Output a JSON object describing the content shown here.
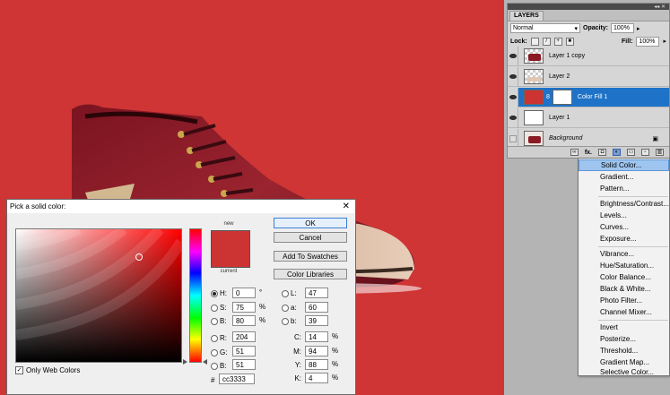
{
  "layers_panel": {
    "tab": "LAYERS",
    "blend_mode": "Normal",
    "opacity_label": "Opacity:",
    "opacity_value": "100%",
    "lock_label": "Lock:",
    "fill_label": "Fill:",
    "fill_value": "100%",
    "layers": [
      {
        "name": "Layer 1 copy",
        "visible": true,
        "selected": false
      },
      {
        "name": "Layer 2",
        "visible": true,
        "selected": false
      },
      {
        "name": "Color Fill 1",
        "visible": true,
        "selected": true
      },
      {
        "name": "Layer 1",
        "visible": true,
        "selected": false
      },
      {
        "name": "Background",
        "visible": false,
        "selected": false
      }
    ],
    "bottom_fx": "fx."
  },
  "adjust_menu": {
    "items": [
      "Solid Color...",
      "Gradient...",
      "Pattern...",
      "Brightness/Contrast...",
      "Levels...",
      "Curves...",
      "Exposure...",
      "Vibrance...",
      "Hue/Saturation...",
      "Color Balance...",
      "Black & White...",
      "Photo Filter...",
      "Channel Mixer...",
      "Invert",
      "Posterize...",
      "Threshold...",
      "Gradient Map...",
      "Selective Color..."
    ],
    "highlighted": "Solid Color..."
  },
  "picker": {
    "title": "Pick a solid color:",
    "new_label": "new",
    "current_label": "current",
    "buttons": {
      "ok": "OK",
      "cancel": "Cancel",
      "swatches": "Add To Swatches",
      "libraries": "Color Libraries"
    },
    "only_web_colors": "Only Web Colors",
    "hsb": {
      "h_label": "H:",
      "h": "0",
      "h_unit": "°",
      "s_label": "S:",
      "s": "75",
      "s_unit": "%",
      "b_label": "B:",
      "b": "80",
      "b_unit": "%"
    },
    "rgb": {
      "r_label": "R:",
      "r": "204",
      "g_label": "G:",
      "g": "51",
      "b_label": "B:",
      "b": "51"
    },
    "lab": {
      "l_label": "L:",
      "l": "47",
      "a_label": "a:",
      "a": "60",
      "b_label": "b:",
      "b": "39"
    },
    "cmyk": {
      "c_label": "C:",
      "c": "14",
      "m_label": "M:",
      "m": "94",
      "y_label": "Y:",
      "y": "88",
      "k_label": "K:",
      "k": "4",
      "unit": "%"
    },
    "hex_label": "#",
    "hex": "cc3333",
    "color": "#cc3333"
  }
}
